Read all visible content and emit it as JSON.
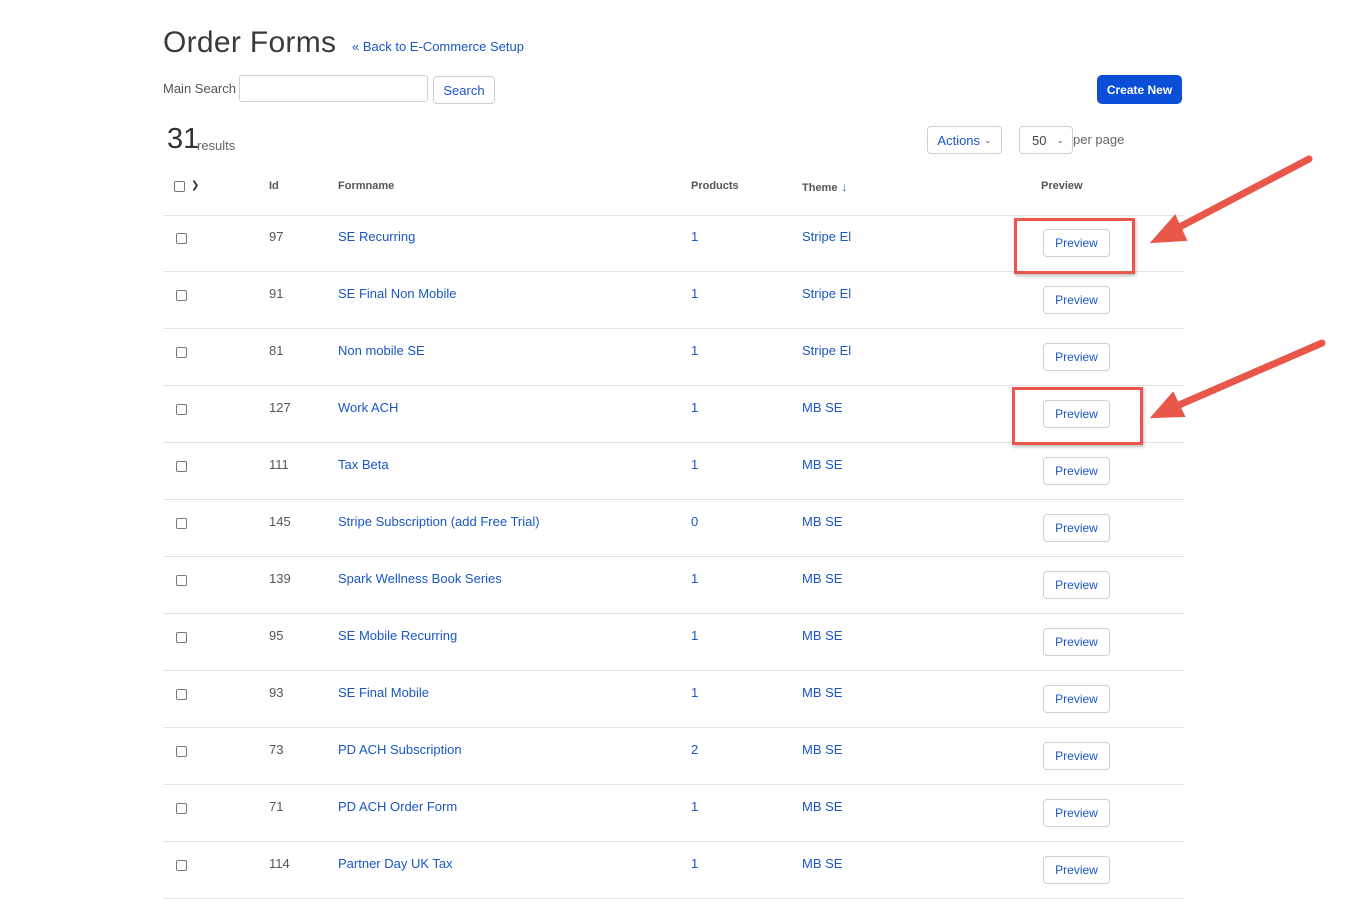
{
  "header": {
    "title": "Order Forms",
    "back_link": "« Back to E-Commerce Setup"
  },
  "search": {
    "label": "Main Search",
    "value": "",
    "placeholder": "",
    "button_label": "Search"
  },
  "create_button_label": "Create New",
  "results": {
    "count": "31",
    "label": "results"
  },
  "toolbar": {
    "actions_label": "Actions",
    "per_page_value": "50",
    "per_page_label": "per page"
  },
  "table": {
    "columns": [
      "Id",
      "Formname",
      "Products",
      "Theme",
      "Preview"
    ],
    "rows": [
      {
        "id": "97",
        "formname": "SE Recurring",
        "products": "1",
        "theme": "Stripe El",
        "preview": "Preview"
      },
      {
        "id": "91",
        "formname": "SE Final Non Mobile",
        "products": "1",
        "theme": "Stripe El",
        "preview": "Preview"
      },
      {
        "id": "81",
        "formname": "Non mobile SE",
        "products": "1",
        "theme": "Stripe El",
        "preview": "Preview"
      },
      {
        "id": "127",
        "formname": "Work ACH",
        "products": "1",
        "theme": "MB SE",
        "preview": "Preview"
      },
      {
        "id": "111",
        "formname": "Tax Beta",
        "products": "1",
        "theme": "MB SE",
        "preview": "Preview"
      },
      {
        "id": "145",
        "formname": "Stripe Subscription (add Free Trial)",
        "products": "0",
        "theme": "MB SE",
        "preview": "Preview"
      },
      {
        "id": "139",
        "formname": "Spark Wellness Book Series",
        "products": "1",
        "theme": "MB SE",
        "preview": "Preview"
      },
      {
        "id": "95",
        "formname": "SE Mobile Recurring",
        "products": "1",
        "theme": "MB SE",
        "preview": "Preview"
      },
      {
        "id": "93",
        "formname": "SE Final Mobile",
        "products": "1",
        "theme": "MB SE",
        "preview": "Preview"
      },
      {
        "id": "73",
        "formname": "PD ACH Subscription",
        "products": "2",
        "theme": "MB SE",
        "preview": "Preview"
      },
      {
        "id": "71",
        "formname": "PD ACH Order Form",
        "products": "1",
        "theme": "MB SE",
        "preview": "Preview"
      },
      {
        "id": "114",
        "formname": "Partner Day UK Tax",
        "products": "1",
        "theme": "MB SE",
        "preview": "Preview"
      }
    ]
  },
  "icons": {
    "sort": "arrow-down-icon",
    "chevron": "chevron-down-icon"
  },
  "colors": {
    "link": "#1a56c4",
    "primary_button": "#0b4fd9",
    "annotation": "#e8574a"
  }
}
